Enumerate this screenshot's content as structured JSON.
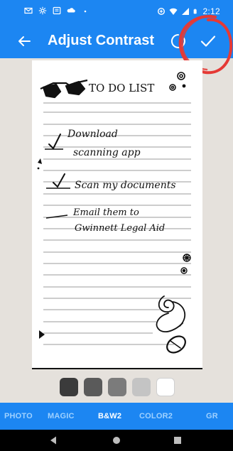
{
  "status_bar": {
    "time": "2:12"
  },
  "toolbar": {
    "title": "Adjust Contrast"
  },
  "document": {
    "heading": "TO DO LIST",
    "items": [
      {
        "checked": true,
        "text": "Download scanning app"
      },
      {
        "checked": true,
        "text": "Scan my documents"
      },
      {
        "checked": false,
        "text": "Email them to Gwinnett Legal Aid"
      }
    ]
  },
  "swatches": [
    {
      "color": "#3b3b3b"
    },
    {
      "color": "#5a5a5a"
    },
    {
      "color": "#7b7b7b"
    },
    {
      "color": "#c4c4c4"
    },
    {
      "color": "#ffffff"
    }
  ],
  "filter_tabs": [
    {
      "label": "PHOTO"
    },
    {
      "label": "MAGIC"
    },
    {
      "label": "B&W2",
      "active": true
    },
    {
      "label": "COLOR2"
    },
    {
      "label": "GR"
    }
  ],
  "colors": {
    "accent": "#1c86f2",
    "inactive_tab": "#9fd1ff",
    "annotation": "#e53935"
  }
}
